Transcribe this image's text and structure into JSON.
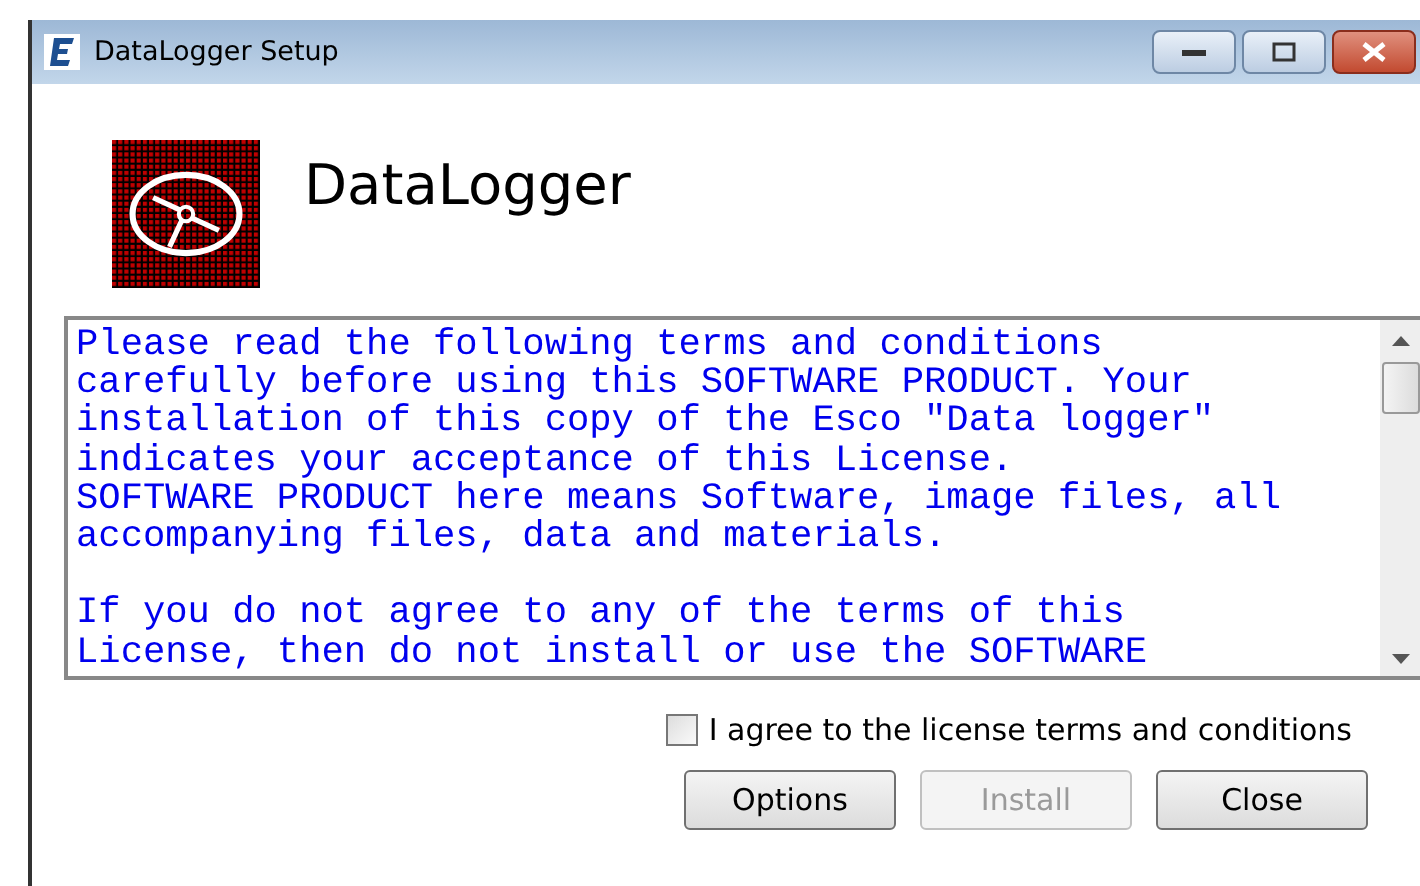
{
  "window": {
    "title": "DataLogger Setup"
  },
  "header": {
    "title": "DataLogger"
  },
  "license": {
    "paragraphs": [
      [
        "Please read the following terms and conditions",
        "carefully before using this SOFTWARE PRODUCT. Your",
        "installation of this copy of the Esco \"Data logger\"",
        "indicates your acceptance of this License.",
        "SOFTWARE PRODUCT here means Software, image files, all",
        "accompanying files, data and materials."
      ],
      [
        "If you do not agree to any of the terms of this",
        "License, then do not install or use the SOFTWARE"
      ]
    ]
  },
  "agree": {
    "label": "I agree to the license terms and conditions",
    "checked": false
  },
  "buttons": [
    {
      "label": "Options",
      "disabled": false
    },
    {
      "label": "Install",
      "disabled": true
    },
    {
      "label": "Close",
      "disabled": false
    }
  ]
}
